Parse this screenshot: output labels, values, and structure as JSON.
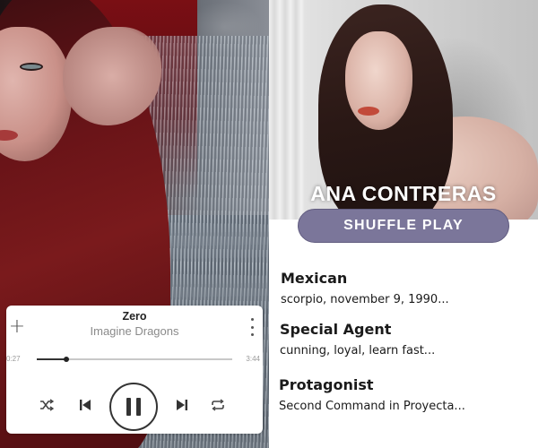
{
  "player": {
    "song_title": "Zero",
    "artist": "Imagine Dragons",
    "time_elapsed": "0:27",
    "time_total": "3:44",
    "progress": 0.15,
    "add_icon": "plus-icon",
    "more_icon": "more-vertical-icon",
    "controls": [
      "shuffle-icon",
      "skip-previous-icon",
      "pause-icon",
      "skip-next-icon",
      "repeat-icon"
    ]
  },
  "profile": {
    "name": "ANA CONTRERAS",
    "button_label": "SHUFFLE PLAY",
    "button_color": "#7b769a",
    "details": [
      {
        "heading": "Mexican",
        "text": "scorpio, november 9, 1990..."
      },
      {
        "heading": "Special Agent",
        "text": "cunning, loyal, learn fast..."
      },
      {
        "heading": "Protagonist",
        "text": "Second Command in Proyecta..."
      }
    ]
  }
}
